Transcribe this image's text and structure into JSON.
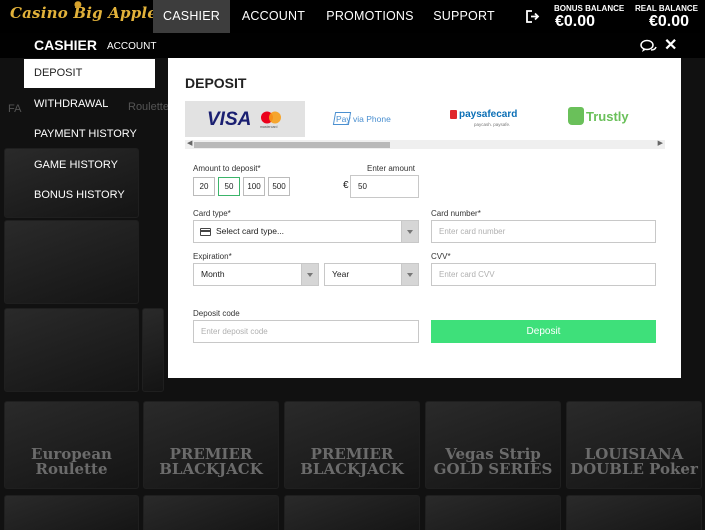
{
  "header": {
    "logo_text": "Casino Big Apple",
    "nav": [
      "CASHIER",
      "ACCOUNT",
      "PROMOTIONS",
      "SUPPORT"
    ],
    "bonus_balance_label": "BONUS BALANCE",
    "bonus_balance_value": "€0.00",
    "real_balance_label": "REAL BALANCE",
    "real_balance_value": "€0.00"
  },
  "subheader": {
    "title": "CASHIER",
    "account_link": "ACCOUNT"
  },
  "sidebar": {
    "items": [
      {
        "label": "DEPOSIT",
        "active": true
      },
      {
        "label": "WITHDRAWAL",
        "active": false
      },
      {
        "label": "PAYMENT HISTORY",
        "active": false
      },
      {
        "label": "GAME HISTORY",
        "active": false
      },
      {
        "label": "BONUS HISTORY",
        "active": false
      }
    ]
  },
  "modal": {
    "title": "DEPOSIT",
    "payment_methods": [
      {
        "name": "VISA",
        "sub": "mastercard",
        "active": true
      },
      {
        "name": "Pay via Phone",
        "active": false
      },
      {
        "name": "paysafecard",
        "sub": "paycash. paysafe.",
        "active": false
      },
      {
        "name": "Trustly",
        "active": false
      }
    ],
    "amount_label": "Amount to deposit*",
    "amount_options": [
      "20",
      "50",
      "100",
      "500"
    ],
    "selected_amount": "50",
    "enter_amount_label": "Enter amount",
    "currency_symbol": "€",
    "amount_value": "50",
    "card_type_label": "Card type*",
    "card_type_value": "Select card type...",
    "card_number_label": "Card number*",
    "card_number_placeholder": "Enter card number",
    "expiration_label": "Expiration*",
    "month_value": "Month",
    "year_value": "Year",
    "cvv_label": "CVV*",
    "cvv_placeholder": "Enter card CVV",
    "deposit_code_label": "Deposit code",
    "deposit_code_placeholder": "Enter deposit code",
    "deposit_button": "Deposit"
  },
  "background": {
    "tiles": [
      "European Roulette",
      "PREMIER BLACKJACK",
      "PREMIER BLACKJACK",
      "Vegas Strip GOLD SERIES",
      "LOUISIANA DOUBLE Poker"
    ],
    "faded_text": [
      "FA",
      "Roulette"
    ]
  },
  "colors": {
    "accent_green": "#3ee07a",
    "gold": "#e2b23a",
    "active_nav": "#3d3d3d"
  }
}
